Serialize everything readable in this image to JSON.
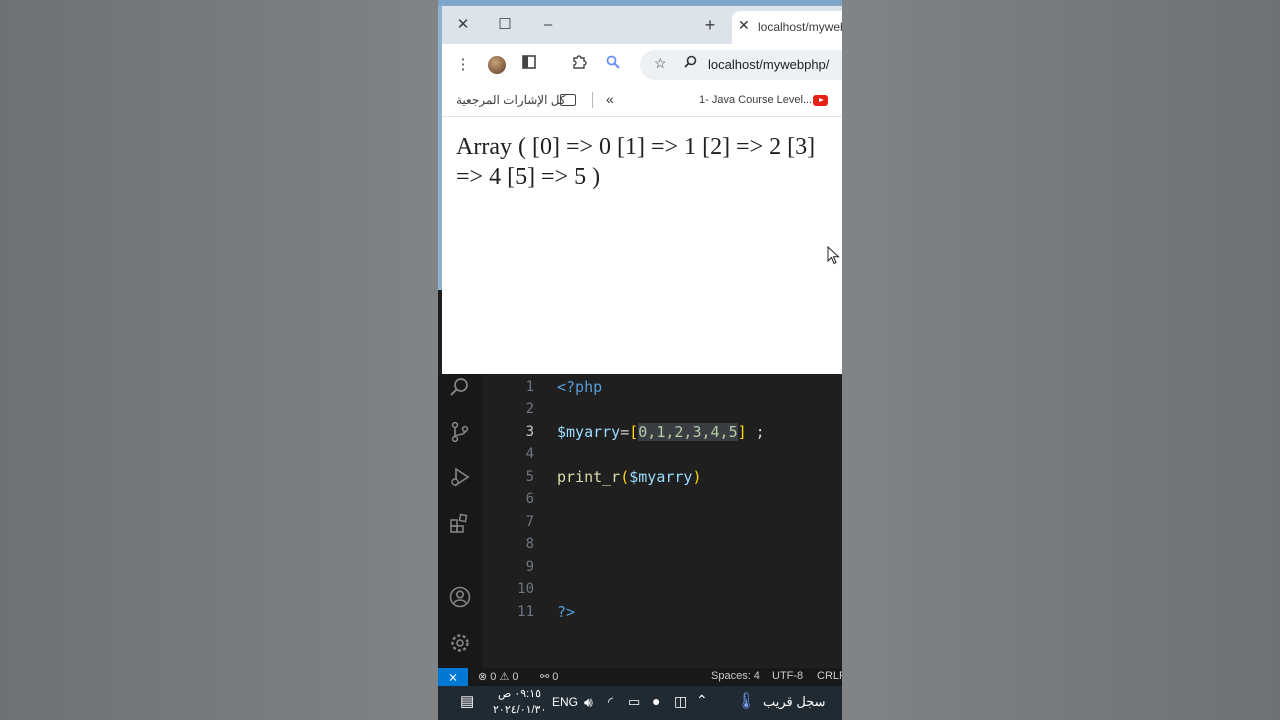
{
  "browser": {
    "tab": {
      "close_glyph": "✕",
      "title": "localhost/myweb"
    },
    "window_controls": {
      "close": "✕",
      "maximize": "☐",
      "minimize": "–",
      "new_tab": "+"
    },
    "address_bar": {
      "url": "localhost/mywebphp/"
    },
    "bookmarks": {
      "all_bookmarks": "كل الإشارات المرجعية",
      "overflow": "«",
      "java_course": "1- Java Course Level..."
    },
    "page_output_line1": "Array ( [0] => 0 [1] => 1 [2] => 2 [3]",
    "page_output_line2": "=> 4 [5] => 5 )"
  },
  "editor": {
    "line_numbers": [
      "1",
      "2",
      "3",
      "4",
      "5",
      "6",
      "7",
      "8",
      "9",
      "10",
      "11"
    ],
    "active_line": "3",
    "code": {
      "l1": "<?php",
      "l3_var": "$myarry",
      "l3_eq": "=",
      "l3_open": "[",
      "l3_nums": "0,1,2,3,4,5",
      "l3_close": "]",
      "l3_end": " ;",
      "l5_fn": "print_r",
      "l5_open": "(",
      "l5_var": "$myarry",
      "l5_close": ")",
      "l11": "?>"
    },
    "status": {
      "errors": "0",
      "warnings": "0",
      "ports": "0",
      "spaces": "Spaces: 4",
      "encoding": "UTF-8",
      "eol": "CRLF"
    }
  },
  "taskbar": {
    "time": "٠٩:١٥ ص",
    "date": "٢٠٢٤/٠١/٣٠",
    "language": "ENG",
    "weather": "سجل قريب"
  },
  "colors": {
    "accent": "#0078d4",
    "editor_bg": "#1f1f1f",
    "keyword": "#569cd6",
    "variable": "#9cdcfe",
    "function": "#dcdcaa",
    "bracket": "#ffd700",
    "number": "#b5cea8"
  }
}
